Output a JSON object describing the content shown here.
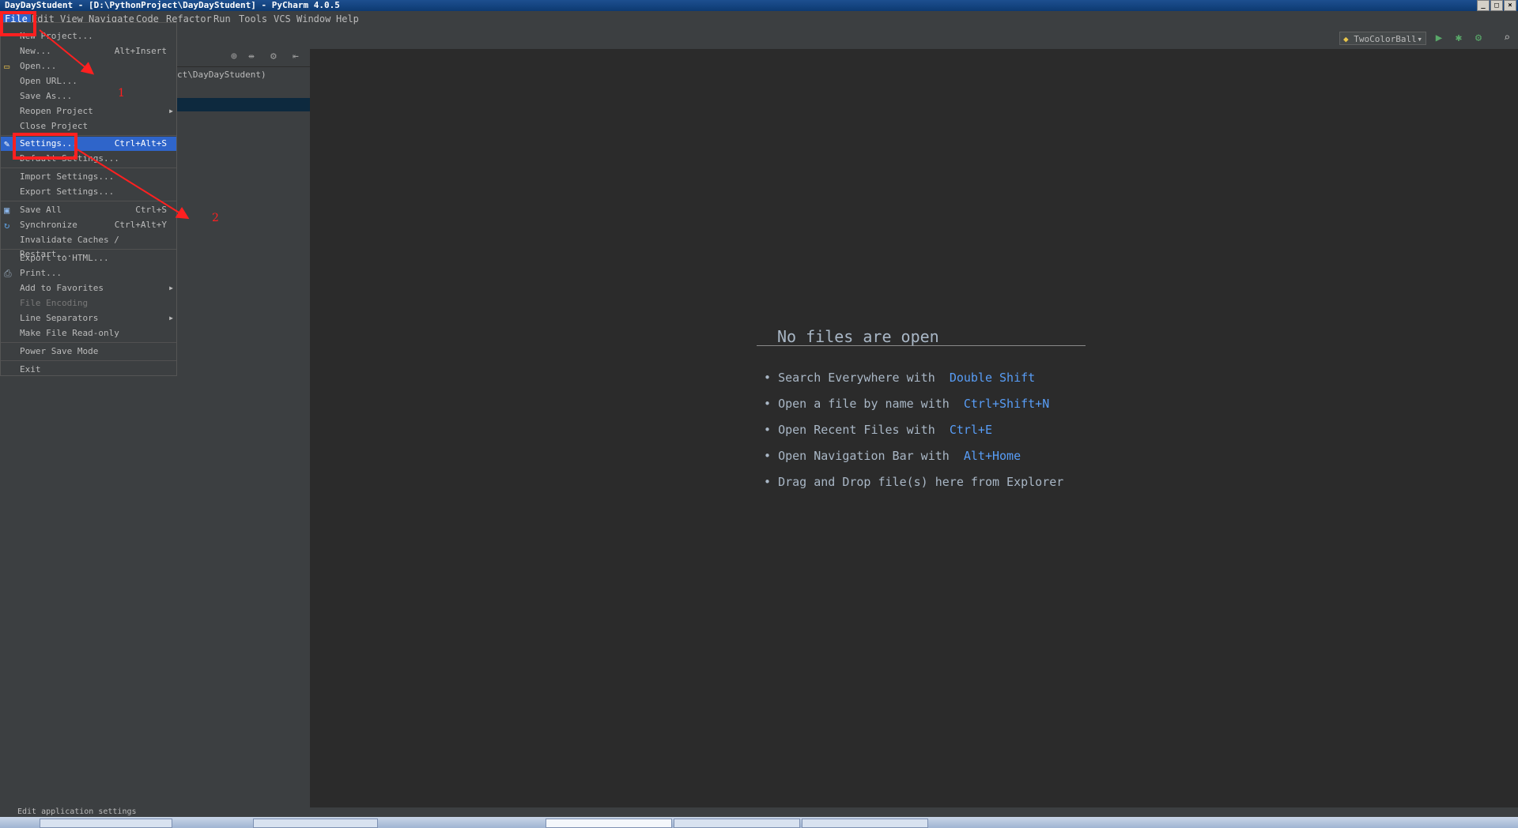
{
  "window": {
    "title": "DayDayStudent - [D:\\PythonProject\\DayDayStudent] - PyCharm 4.0.5"
  },
  "menubar": [
    "File",
    "Edit",
    "View",
    "Navigate",
    "Code",
    "Refactor",
    "Run",
    "Tools",
    "VCS",
    "Window",
    "Help"
  ],
  "toolbar": {
    "run_config": "TwoColorBall"
  },
  "project": {
    "path_fragment": "ct\\DayDayStudent)"
  },
  "file_menu": {
    "items": [
      {
        "label": "New Project...",
        "shortcut": ""
      },
      {
        "label": "New...",
        "shortcut": "Alt+Insert"
      },
      {
        "label": "Open...",
        "shortcut": "",
        "icon": "folder-icon"
      },
      {
        "label": "Open URL...",
        "shortcut": ""
      },
      {
        "label": "Save As...",
        "shortcut": ""
      },
      {
        "label": "Reopen Project",
        "shortcut": "",
        "submenu": true
      },
      {
        "label": "Close Project",
        "shortcut": ""
      },
      {
        "label": "Settings...",
        "shortcut": "Ctrl+Alt+S",
        "selected": true,
        "icon": "wrench-icon"
      },
      {
        "label": "Default Settings...",
        "shortcut": ""
      },
      {
        "label": "Import Settings...",
        "shortcut": ""
      },
      {
        "label": "Export Settings...",
        "shortcut": ""
      },
      {
        "label": "Save All",
        "shortcut": "Ctrl+S",
        "icon": "floppy-icon"
      },
      {
        "label": "Synchronize",
        "shortcut": "Ctrl+Alt+Y",
        "icon": "sync-icon"
      },
      {
        "label": "Invalidate Caches / Restart...",
        "shortcut": ""
      },
      {
        "label": "Export to HTML...",
        "shortcut": ""
      },
      {
        "label": "Print...",
        "shortcut": "",
        "icon": "printer-icon"
      },
      {
        "label": "Add to Favorites",
        "shortcut": "",
        "submenu": true
      },
      {
        "label": "File Encoding",
        "shortcut": "",
        "disabled": true
      },
      {
        "label": "Line Separators",
        "shortcut": "",
        "submenu": true
      },
      {
        "label": "Make File Read-only",
        "shortcut": ""
      },
      {
        "label": "Power Save Mode",
        "shortcut": ""
      },
      {
        "label": "Exit",
        "shortcut": ""
      }
    ]
  },
  "editor": {
    "empty_title": "No files are open",
    "hints": [
      {
        "text": "Search Everywhere with",
        "key": "Double Shift"
      },
      {
        "text": "Open a file by name with",
        "key": "Ctrl+Shift+N"
      },
      {
        "text": "Open Recent Files with",
        "key": "Ctrl+E"
      },
      {
        "text": "Open Navigation Bar with",
        "key": "Alt+Home"
      },
      {
        "text": "Drag and Drop file(s) here from Explorer",
        "key": ""
      }
    ]
  },
  "annotations": {
    "step1": "1",
    "step2": "2"
  },
  "statusbar": {
    "text": "Edit application settings"
  },
  "colors": {
    "selection": "#2f65ca",
    "annotation": "#ff2020",
    "key_hint": "#589df6"
  }
}
